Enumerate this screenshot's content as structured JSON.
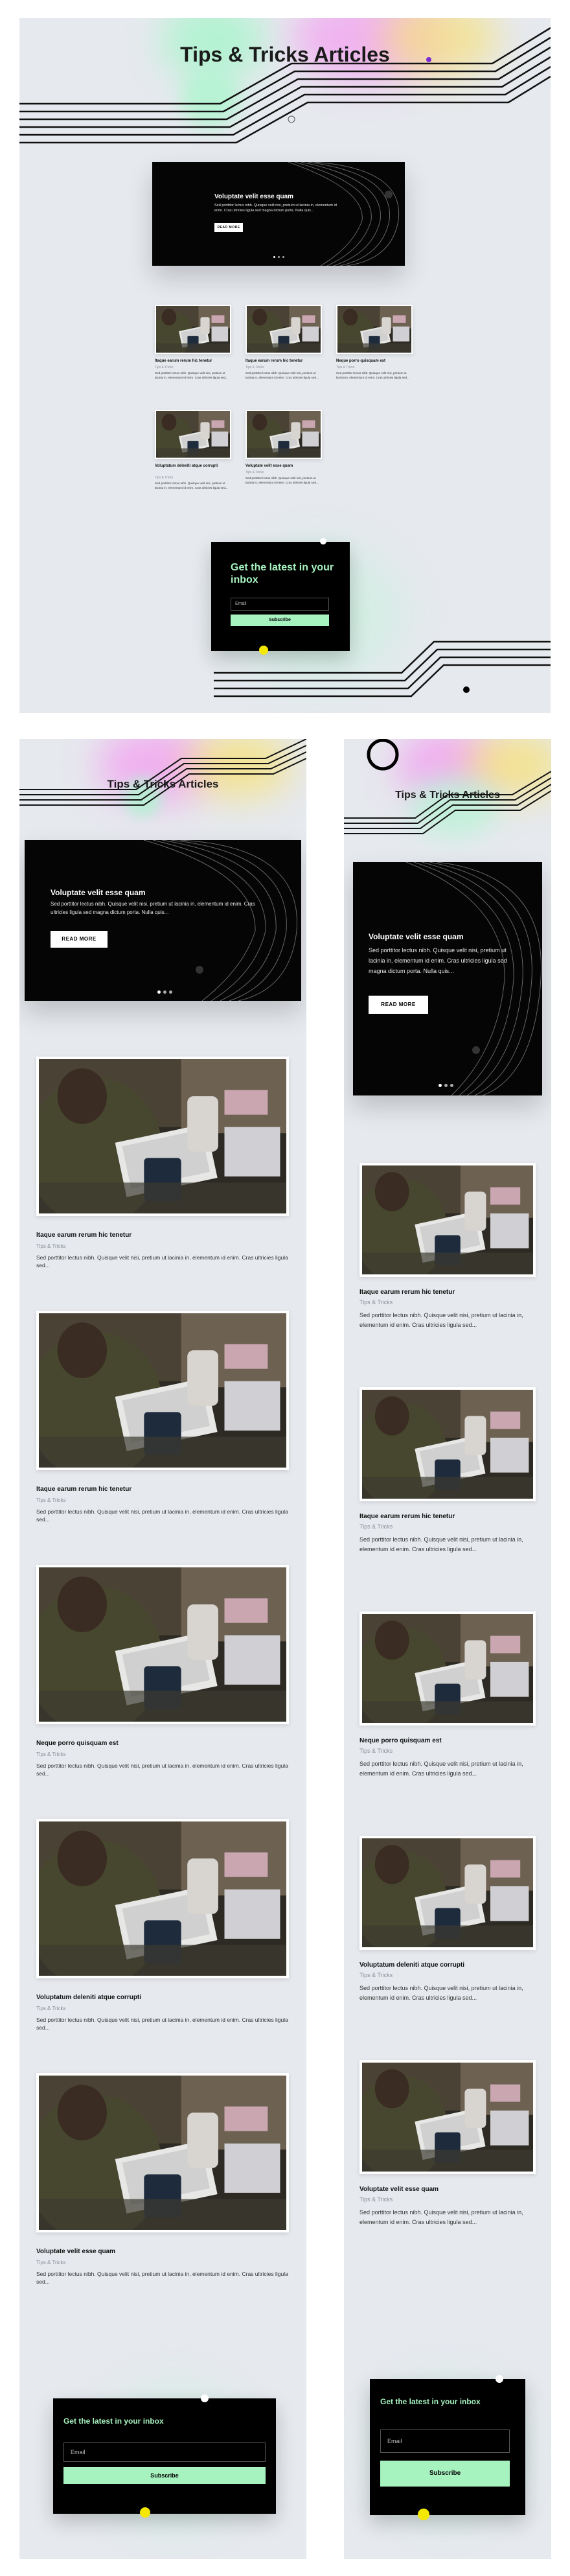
{
  "page_title": "Tips & Tricks Articles",
  "hero": {
    "title": "Voluptate velit esse quam",
    "text": "Sed porttitor lectus nibh. Quisque velit nisi, pretium ut lacinia in, elementum id enim. Cras ultricies ligula sed magna dictum porta. Nulla quis...",
    "button": "READ MORE"
  },
  "posts": [
    {
      "title": "Itaque earum rerum hic tenetur",
      "category": "Tips & Tricks",
      "excerpt": "Sed porttitor lectus nibh. Quisque velit nisi, pretium ut lacinia in, elementum id enim. Cras ultricies ligula sed..."
    },
    {
      "title": "Itaque earum rerum hic tenetur",
      "category": "Tips & Tricks",
      "excerpt": "Sed porttitor lectus nibh. Quisque velit nisi, pretium ut lacinia in, elementum id enim. Cras ultricies ligula sed..."
    },
    {
      "title": "Neque porro quisquam est",
      "category": "Tips & Tricks",
      "excerpt": "Sed porttitor lectus nibh. Quisque velit nisi, pretium ut lacinia in, elementum id enim. Cras ultricies ligula sed..."
    },
    {
      "title": "Voluptatum deleniti atque corrupti",
      "category": "Tips & Tricks",
      "excerpt": "Sed porttitor lectus nibh. Quisque velit nisi, pretium ut lacinia in, elementum id enim. Cras ultricies ligula sed..."
    },
    {
      "title": "Voluptate velit esse quam",
      "category": "Tips & Tricks",
      "excerpt": "Sed porttitor lectus nibh. Quisque velit nisi, pretium ut lacinia in, elementum id enim. Cras ultricies ligula sed..."
    }
  ],
  "newsletter": {
    "title": "Get the latest in your inbox",
    "email_placeholder": "Email",
    "button": "Subscribe"
  },
  "colors": {
    "accent_green": "#a7f3c0",
    "accent_yellow": "#f5e800",
    "panel_bg": "#e6e9ee",
    "hero_bg": "#050505"
  }
}
